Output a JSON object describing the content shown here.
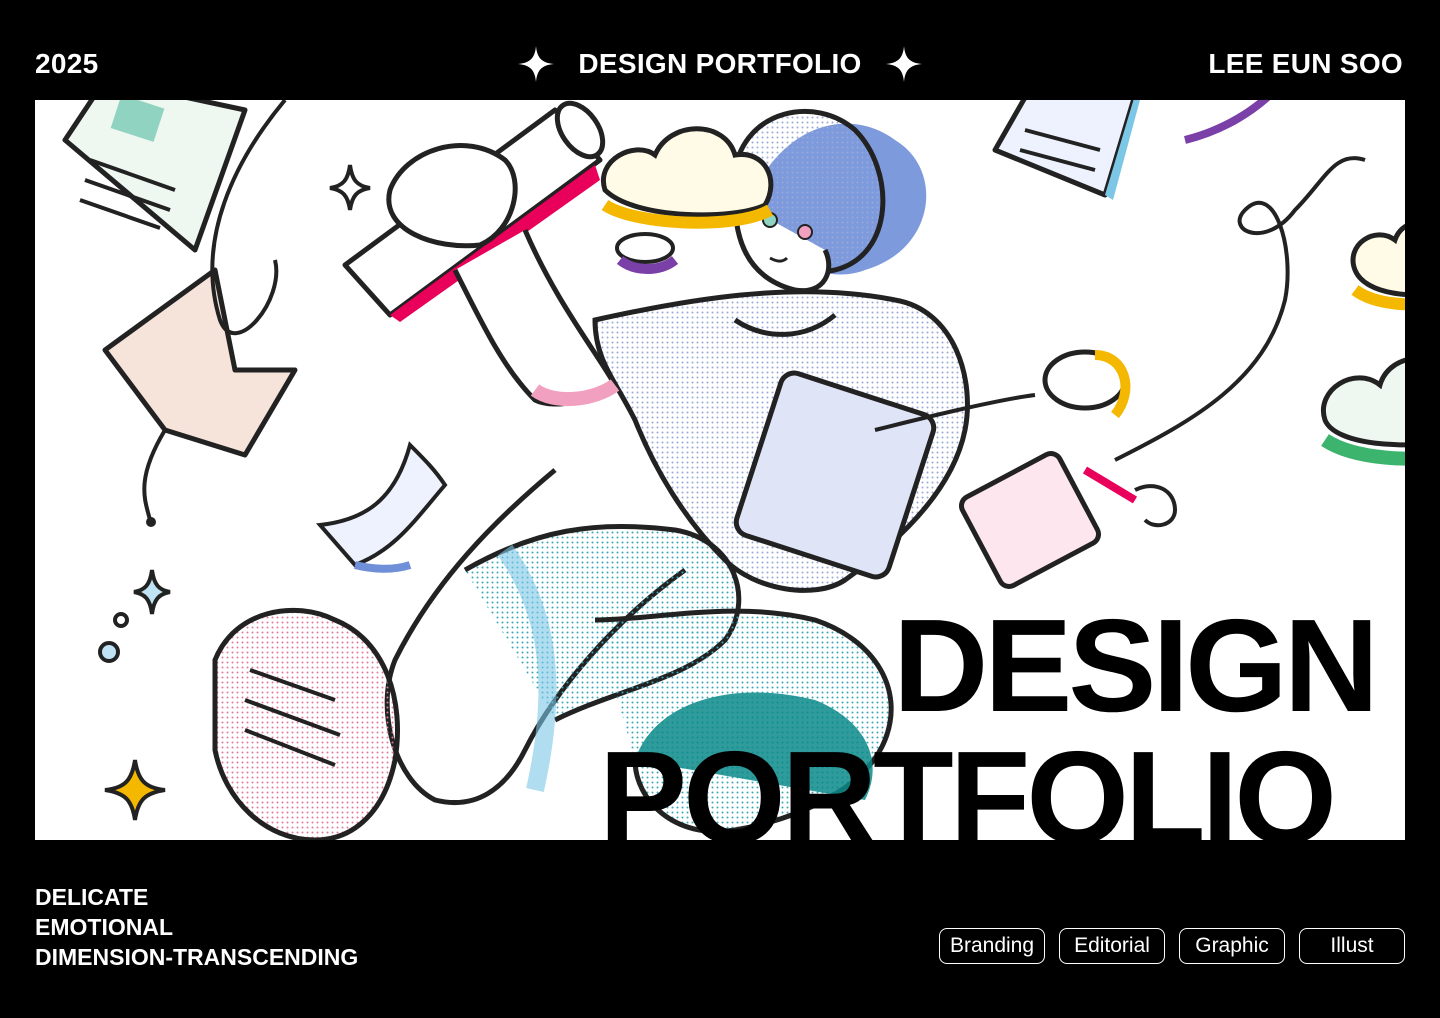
{
  "header": {
    "year": "2025",
    "title": "DESIGN PORTFOLIO",
    "author": "LEE EUN SOO",
    "ornament_icon": "four-point-sparkle-icon"
  },
  "cover": {
    "headline_line1": "DESIGN",
    "headline_line2": "PORTFOLIO"
  },
  "footer": {
    "traits": [
      "DELICATE",
      "EMOTIONAL",
      "DIMENSION-TRANSCENDING"
    ],
    "tags": [
      "Branding",
      "Editorial",
      "Graphic",
      "Illust"
    ]
  },
  "colors": {
    "background": "#000000",
    "artboard": "#ffffff",
    "accent_pink": "#e8005a",
    "accent_blue": "#6f8fd8",
    "accent_yellow": "#f5b800",
    "accent_teal": "#0a8a8a",
    "accent_green": "#3cb46e",
    "accent_purple": "#7b3fa8"
  }
}
